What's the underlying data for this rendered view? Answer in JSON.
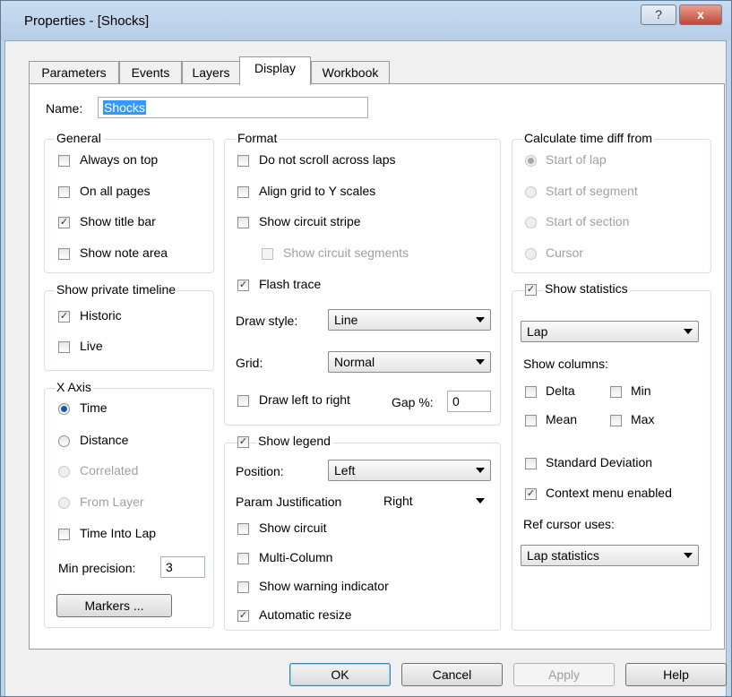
{
  "window": {
    "title": "Properties - [Shocks]",
    "help_glyph": "?",
    "close_glyph": "x"
  },
  "tabs": [
    "Parameters",
    "Events",
    "Layers",
    "Display",
    "Workbook"
  ],
  "active_tab": "Display",
  "name_field": {
    "label": "Name:",
    "value": "Shocks"
  },
  "general": {
    "title": "General",
    "always_on_top": {
      "label": "Always on top",
      "checked": false
    },
    "on_all_pages": {
      "label": "On all pages",
      "checked": false
    },
    "show_title_bar": {
      "label": "Show title bar",
      "checked": true
    },
    "show_note_area": {
      "label": "Show note area",
      "checked": false
    }
  },
  "private_timeline": {
    "title": "Show private timeline",
    "historic": {
      "label": "Historic",
      "checked": true
    },
    "live": {
      "label": "Live",
      "checked": false
    }
  },
  "x_axis": {
    "title": "X Axis",
    "time": {
      "label": "Time",
      "selected": true
    },
    "distance": {
      "label": "Distance",
      "selected": false
    },
    "correlated": {
      "label": "Correlated",
      "disabled": true
    },
    "from_layer": {
      "label": "From Layer",
      "disabled": true
    },
    "time_into_lap": {
      "label": "Time Into Lap",
      "checked": false
    },
    "min_precision_label": "Min precision:",
    "min_precision_value": "3",
    "markers_button": "Markers ..."
  },
  "format": {
    "title": "Format",
    "no_scroll": {
      "label": "Do not scroll across laps",
      "checked": false
    },
    "align_grid": {
      "label": "Align grid to Y scales",
      "checked": false
    },
    "circuit_stripe": {
      "label": "Show circuit stripe",
      "checked": false
    },
    "circuit_segments": {
      "label": "Show circuit segments",
      "checked": false,
      "disabled": true
    },
    "flash_trace": {
      "label": "Flash trace",
      "checked": true
    },
    "draw_style_label": "Draw style:",
    "draw_style_value": "Line",
    "grid_label": "Grid:",
    "grid_value": "Normal",
    "draw_ltr": {
      "label": "Draw left to right",
      "checked": false
    },
    "gap_label": "Gap %:",
    "gap_value": "0"
  },
  "legend": {
    "title": "Show legend",
    "checked": true,
    "position_label": "Position:",
    "position_value": "Left",
    "justification_label": "Param Justification",
    "justification_value": "Right",
    "show_circuit": {
      "label": "Show circuit",
      "checked": false
    },
    "multi_column": {
      "label": "Multi-Column",
      "checked": false
    },
    "warning_indicator": {
      "label": "Show warning indicator",
      "checked": false
    },
    "auto_resize": {
      "label": "Automatic resize",
      "checked": true
    }
  },
  "time_diff": {
    "title": "Calculate time diff from",
    "start_of_lap": {
      "label": "Start of lap",
      "selected": true
    },
    "start_of_segment": {
      "label": "Start of segment",
      "selected": false
    },
    "start_of_section": {
      "label": "Start of section",
      "selected": false
    },
    "cursor": {
      "label": "Cursor",
      "selected": false
    }
  },
  "statistics": {
    "title": "Show statistics",
    "checked": true,
    "mode_value": "Lap",
    "columns_label": "Show columns:",
    "delta": {
      "label": "Delta",
      "checked": false
    },
    "min": {
      "label": "Min",
      "checked": false
    },
    "mean": {
      "label": "Mean",
      "checked": false
    },
    "max": {
      "label": "Max",
      "checked": false
    },
    "std_dev": {
      "label": "Standard Deviation",
      "checked": false
    },
    "context_menu": {
      "label": "Context menu enabled",
      "checked": true
    },
    "ref_cursor_label": "Ref cursor uses:",
    "ref_cursor_value": "Lap statistics"
  },
  "buttons": {
    "ok": "OK",
    "cancel": "Cancel",
    "apply": "Apply",
    "help": "Help"
  },
  "check_glyph": "✓"
}
